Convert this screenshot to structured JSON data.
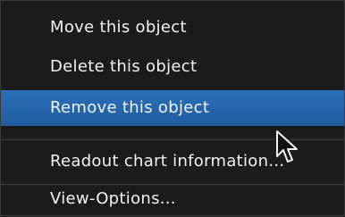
{
  "menu": {
    "items": [
      {
        "label": "Move this object",
        "state": "normal"
      },
      {
        "label": "Delete this object",
        "state": "normal"
      },
      {
        "label": "Remove this object",
        "state": "selected"
      },
      {
        "label": "Readout chart information...",
        "state": "normal"
      },
      {
        "label": "View-Options...",
        "state": "normal"
      }
    ]
  },
  "colors": {
    "menu_background": "#1b1b1b",
    "selected_background": "#2a6fb8",
    "text": "#f2f2f2",
    "separator": "#3e3e3e"
  },
  "icons": {
    "pointer": "mouse-cursor-icon"
  }
}
